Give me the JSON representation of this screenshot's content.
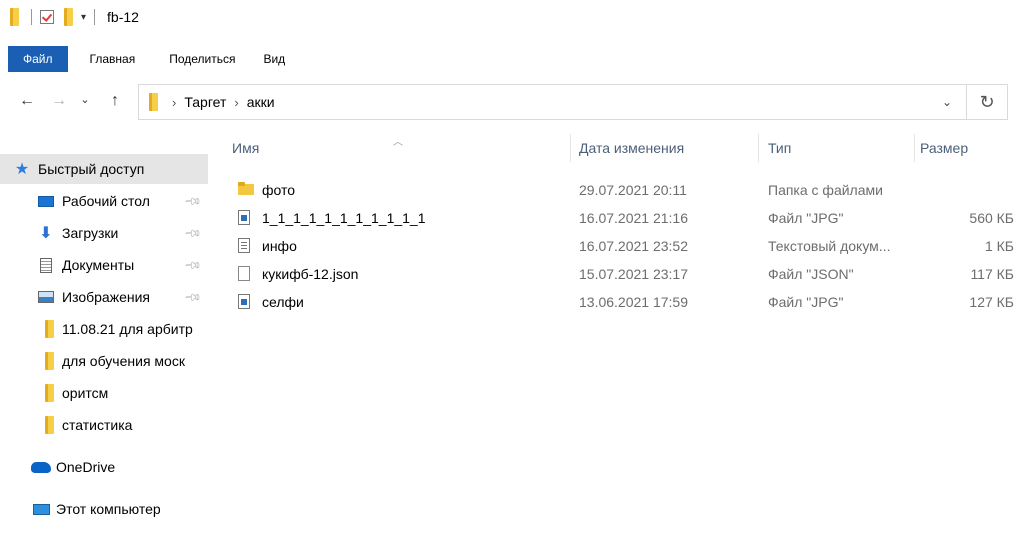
{
  "window": {
    "title": "fb-12"
  },
  "ribbon": {
    "tabs": [
      {
        "label": "Файл"
      },
      {
        "label": "Главная"
      },
      {
        "label": "Поделиться"
      },
      {
        "label": "Вид"
      }
    ]
  },
  "address": {
    "breadcrumbs": [
      "Таргет",
      "акки"
    ]
  },
  "columns": {
    "name": "Имя",
    "date": "Дата изменения",
    "type": "Тип",
    "size": "Размер"
  },
  "files": [
    {
      "name": "фото",
      "date": "29.07.2021 20:11",
      "type": "Папка с файлами",
      "size": "",
      "icon": "folder-icon"
    },
    {
      "name": "1_1_1_1_1_1_1_1_1_1_1",
      "date": "16.07.2021 21:16",
      "type": "Файл \"JPG\"",
      "size": "560 КБ",
      "icon": "image-file-icon"
    },
    {
      "name": "инфо",
      "date": "16.07.2021 23:52",
      "type": "Текстовый докум...",
      "size": "1 КБ",
      "icon": "text-file-icon"
    },
    {
      "name": "кукифб-12.json",
      "date": "15.07.2021 23:17",
      "type": "Файл \"JSON\"",
      "size": "117 КБ",
      "icon": "file-icon"
    },
    {
      "name": "селфи",
      "date": "13.06.2021 17:59",
      "type": "Файл \"JPG\"",
      "size": "127 КБ",
      "icon": "image-file-icon"
    }
  ],
  "navpane": {
    "quick_access": "Быстрый доступ",
    "items": [
      {
        "label": "Рабочий стол",
        "icon": "desktop-icon",
        "pinned": true
      },
      {
        "label": "Загрузки",
        "icon": "download-icon",
        "pinned": true
      },
      {
        "label": "Документы",
        "icon": "documents-icon",
        "pinned": true
      },
      {
        "label": "Изображения",
        "icon": "pictures-icon",
        "pinned": true
      },
      {
        "label": "11.08.21 для арбитр",
        "icon": "folder-icon",
        "pinned": false
      },
      {
        "label": "для обучения моск",
        "icon": "folder-icon",
        "pinned": false
      },
      {
        "label": "оритсм",
        "icon": "folder-icon",
        "pinned": false
      },
      {
        "label": "статистика",
        "icon": "folder-icon",
        "pinned": false
      }
    ],
    "onedrive": "OneDrive",
    "this_pc": "Этот компьютер"
  },
  "colors": {
    "file_tab": "#1a5fb4",
    "header_text": "#4c607a",
    "selected_nav": "#e5e5e5",
    "folder": "#f3c73f"
  }
}
